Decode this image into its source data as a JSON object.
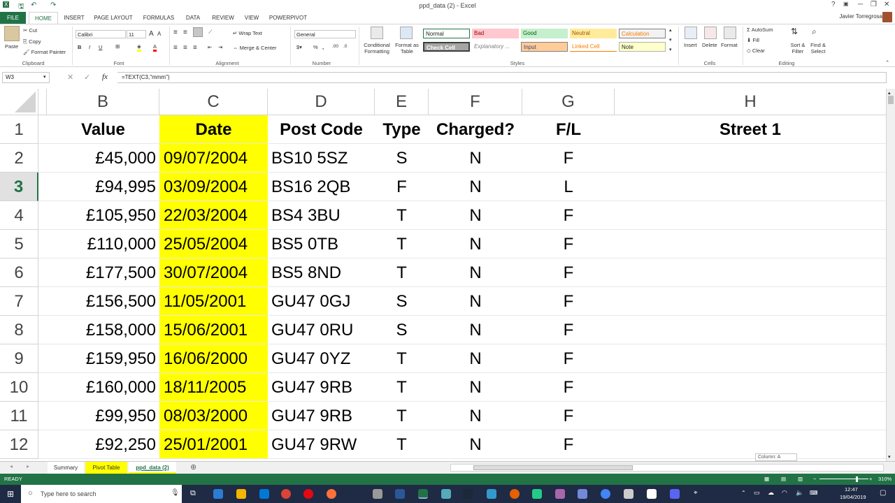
{
  "window": {
    "title": "ppd_data (2) - Excel",
    "help": "?",
    "minimize": "─",
    "restore": "❐",
    "close": "✕"
  },
  "ribbon_tabs": [
    "FILE",
    "HOME",
    "INSERT",
    "PAGE LAYOUT",
    "FORMULAS",
    "DATA",
    "REVIEW",
    "VIEW",
    "POWERPIVOT"
  ],
  "user": "Javier Torregrosa",
  "clipboard": {
    "paste": "Paste",
    "cut": "Cut",
    "copy": "Copy",
    "format_painter": "Format Painter",
    "label": "Clipboard"
  },
  "font": {
    "name": "Calibri",
    "size": "11",
    "bold": "B",
    "italic": "I",
    "underline": "U",
    "label": "Font"
  },
  "alignment": {
    "wrap": "Wrap Text",
    "merge": "Merge & Center",
    "label": "Alignment"
  },
  "number": {
    "format": "General",
    "label": "Number"
  },
  "styles": {
    "cond": "Conditional Formatting",
    "table": "Format as Table",
    "items": [
      {
        "name": "Normal",
        "bg": "#ffffff",
        "fg": "#000000"
      },
      {
        "name": "Bad",
        "bg": "#ffc7ce",
        "fg": "#9c0006"
      },
      {
        "name": "Good",
        "bg": "#c6efce",
        "fg": "#006100"
      },
      {
        "name": "Neutral",
        "bg": "#ffeb9c",
        "fg": "#9c5700"
      },
      {
        "name": "Calculation",
        "bg": "#f2f2f2",
        "fg": "#fa7d00"
      },
      {
        "name": "Check Cell",
        "bg": "#a5a5a5",
        "fg": "#ffffff"
      },
      {
        "name": "Explanatory ...",
        "bg": "#ffffff",
        "fg": "#7f7f7f"
      },
      {
        "name": "Input",
        "bg": "#ffcc99",
        "fg": "#3f3f76"
      },
      {
        "name": "Linked Cell",
        "bg": "#ffffff",
        "fg": "#fa7d00"
      },
      {
        "name": "Note",
        "bg": "#ffffcc",
        "fg": "#000000"
      }
    ],
    "label": "Styles"
  },
  "cells_grp": {
    "insert": "Insert",
    "delete": "Delete",
    "format": "Format",
    "label": "Cells"
  },
  "editing": {
    "autosum": "AutoSum",
    "fill": "Fill",
    "clear": "Clear",
    "sort": "Sort & Filter",
    "find": "Find & Select",
    "label": "Editing"
  },
  "formula_bar": {
    "name_box": "W3",
    "fx": "fx",
    "formula": "=TEXT(C3,\"mmm\")"
  },
  "columns": [
    "B",
    "C",
    "D",
    "E",
    "F",
    "G",
    "H"
  ],
  "header_row": {
    "num": "1",
    "cells": [
      "Value",
      "Date",
      "Post Code",
      "Type",
      "Charged?",
      "F/L",
      "Street 1"
    ]
  },
  "rows": [
    {
      "num": "2",
      "cells": [
        "£45,000",
        "09/07/2004",
        "BS10 5SZ",
        "S",
        "N",
        "F",
        ""
      ]
    },
    {
      "num": "3",
      "cells": [
        "£94,995",
        "03/09/2004",
        "BS16 2QB",
        "F",
        "N",
        "L",
        ""
      ]
    },
    {
      "num": "4",
      "cells": [
        "£105,950",
        "22/03/2004",
        "BS4 3BU",
        "T",
        "N",
        "F",
        ""
      ]
    },
    {
      "num": "5",
      "cells": [
        "£110,000",
        "25/05/2004",
        "BS5 0TB",
        "T",
        "N",
        "F",
        ""
      ]
    },
    {
      "num": "6",
      "cells": [
        "£177,500",
        "30/07/2004",
        "BS5 8ND",
        "T",
        "N",
        "F",
        ""
      ]
    },
    {
      "num": "7",
      "cells": [
        "£156,500",
        "11/05/2001",
        "GU47 0GJ",
        "S",
        "N",
        "F",
        ""
      ]
    },
    {
      "num": "8",
      "cells": [
        "£158,000",
        "15/06/2001",
        "GU47 0RU",
        "S",
        "N",
        "F",
        ""
      ]
    },
    {
      "num": "9",
      "cells": [
        "£159,950",
        "16/06/2000",
        "GU47 0YZ",
        "T",
        "N",
        "F",
        ""
      ]
    },
    {
      "num": "10",
      "cells": [
        "£160,000",
        "18/11/2005",
        "GU47 9RB",
        "T",
        "N",
        "F",
        ""
      ]
    },
    {
      "num": "11",
      "cells": [
        "£99,950",
        "08/03/2000",
        "GU47 9RB",
        "T",
        "N",
        "F",
        ""
      ]
    },
    {
      "num": "12",
      "cells": [
        "£92,250",
        "25/01/2001",
        "GU47 9RW",
        "T",
        "N",
        "F",
        ""
      ]
    }
  ],
  "sheet_tabs": [
    "Summary",
    "Pivot Table",
    "ppd_data (2)"
  ],
  "tooltip": "Column: A",
  "status": {
    "ready": "READY",
    "zoom": "310%"
  },
  "taskbar": {
    "search": "Type here to search",
    "time": "12:47",
    "date": "19/04/2019"
  },
  "colors": {
    "excel_green": "#217346",
    "yellow": "#ffff00"
  }
}
